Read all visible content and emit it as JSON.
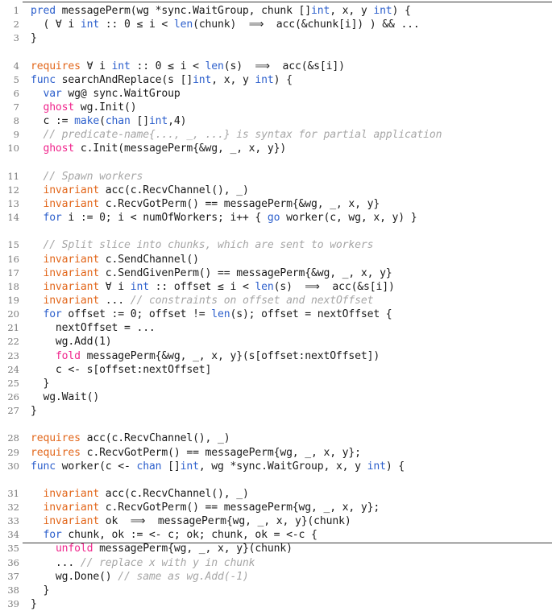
{
  "figure": {
    "kind": "code-listing",
    "language": "Gobra (Go verification)",
    "rule_color": "#3a3a3a",
    "background": "#ffffff"
  },
  "colors": {
    "keyword_blue": "#2c5fcc",
    "spec_orange": "#e2661a",
    "ghost_pink": "#f0258c",
    "comment_gray": "#a6a6a6",
    "text_black": "#1a1a1a",
    "lineno_gray": "#7b7b7b"
  },
  "lines": [
    {
      "n": "1",
      "tokens": [
        {
          "t": "pred",
          "c": "k-blue"
        },
        {
          "t": " messagePerm(wg *sync.WaitGroup, chunk []",
          "c": "plain"
        },
        {
          "t": "int",
          "c": "k-blue"
        },
        {
          "t": ", x, y ",
          "c": "plain"
        },
        {
          "t": "int",
          "c": "k-blue"
        },
        {
          "t": ") {",
          "c": "plain"
        }
      ]
    },
    {
      "n": "2",
      "tokens": [
        {
          "t": "  ( ∀ i ",
          "c": "plain"
        },
        {
          "t": "int",
          "c": "k-blue"
        },
        {
          "t": " :: 0 ≤ i < ",
          "c": "plain"
        },
        {
          "t": "len",
          "c": "k-blue"
        },
        {
          "t": "(chunk)  ⟹  acc(&chunk[i]) ) && ...",
          "c": "plain"
        }
      ]
    },
    {
      "n": "3",
      "tokens": [
        {
          "t": "}",
          "c": "plain"
        }
      ]
    },
    {
      "n": "",
      "tokens": [
        {
          "t": " ",
          "c": "plain"
        }
      ]
    },
    {
      "n": "4",
      "tokens": [
        {
          "t": "requires",
          "c": "k-orange"
        },
        {
          "t": " ∀ i ",
          "c": "plain"
        },
        {
          "t": "int",
          "c": "k-blue"
        },
        {
          "t": " :: 0 ≤ i < ",
          "c": "plain"
        },
        {
          "t": "len",
          "c": "k-blue"
        },
        {
          "t": "(s)  ⟹  acc(&s[i])",
          "c": "plain"
        }
      ]
    },
    {
      "n": "5",
      "tokens": [
        {
          "t": "func",
          "c": "k-blue"
        },
        {
          "t": " searchAndReplace(s []",
          "c": "plain"
        },
        {
          "t": "int",
          "c": "k-blue"
        },
        {
          "t": ", x, y ",
          "c": "plain"
        },
        {
          "t": "int",
          "c": "k-blue"
        },
        {
          "t": ") {",
          "c": "plain"
        }
      ]
    },
    {
      "n": "6",
      "tokens": [
        {
          "t": "  ",
          "c": "plain"
        },
        {
          "t": "var",
          "c": "k-blue"
        },
        {
          "t": " wg@ sync.WaitGroup",
          "c": "plain"
        }
      ]
    },
    {
      "n": "7",
      "tokens": [
        {
          "t": "  ",
          "c": "plain"
        },
        {
          "t": "ghost",
          "c": "k-pink"
        },
        {
          "t": " wg.Init()",
          "c": "plain"
        }
      ]
    },
    {
      "n": "8",
      "tokens": [
        {
          "t": "  c := ",
          "c": "plain"
        },
        {
          "t": "make",
          "c": "k-blue"
        },
        {
          "t": "(",
          "c": "plain"
        },
        {
          "t": "chan",
          "c": "k-blue"
        },
        {
          "t": " []",
          "c": "plain"
        },
        {
          "t": "int",
          "c": "k-blue"
        },
        {
          "t": ",4)",
          "c": "plain"
        }
      ]
    },
    {
      "n": "9",
      "tokens": [
        {
          "t": "  // predicate-name{..., _, ...} is syntax for partial application",
          "c": "cmt"
        }
      ]
    },
    {
      "n": "10",
      "tokens": [
        {
          "t": "  ",
          "c": "plain"
        },
        {
          "t": "ghost",
          "c": "k-pink"
        },
        {
          "t": " c.Init(messagePerm{&wg, _, x, y})",
          "c": "plain"
        }
      ]
    },
    {
      "n": "",
      "tokens": [
        {
          "t": " ",
          "c": "plain"
        }
      ]
    },
    {
      "n": "11",
      "tokens": [
        {
          "t": "  // Spawn workers",
          "c": "cmt"
        }
      ]
    },
    {
      "n": "12",
      "tokens": [
        {
          "t": "  ",
          "c": "plain"
        },
        {
          "t": "invariant",
          "c": "k-orange"
        },
        {
          "t": " acc(c.RecvChannel(), _)",
          "c": "plain"
        }
      ]
    },
    {
      "n": "13",
      "tokens": [
        {
          "t": "  ",
          "c": "plain"
        },
        {
          "t": "invariant",
          "c": "k-orange"
        },
        {
          "t": " c.RecvGotPerm() == messagePerm{&wg, _, x, y}",
          "c": "plain"
        }
      ]
    },
    {
      "n": "14",
      "tokens": [
        {
          "t": "  ",
          "c": "plain"
        },
        {
          "t": "for",
          "c": "k-blue"
        },
        {
          "t": " i := 0; i < numOfWorkers; i++ { ",
          "c": "plain"
        },
        {
          "t": "go",
          "c": "k-blue"
        },
        {
          "t": " worker(c, wg, x, y) }",
          "c": "plain"
        }
      ]
    },
    {
      "n": "",
      "tokens": [
        {
          "t": " ",
          "c": "plain"
        }
      ]
    },
    {
      "n": "15",
      "tokens": [
        {
          "t": "  // Split slice into chunks, which are sent to workers",
          "c": "cmt"
        }
      ]
    },
    {
      "n": "16",
      "tokens": [
        {
          "t": "  ",
          "c": "plain"
        },
        {
          "t": "invariant",
          "c": "k-orange"
        },
        {
          "t": " c.SendChannel()",
          "c": "plain"
        }
      ]
    },
    {
      "n": "17",
      "tokens": [
        {
          "t": "  ",
          "c": "plain"
        },
        {
          "t": "invariant",
          "c": "k-orange"
        },
        {
          "t": " c.SendGivenPerm() == messagePerm{&wg, _, x, y}",
          "c": "plain"
        }
      ]
    },
    {
      "n": "18",
      "tokens": [
        {
          "t": "  ",
          "c": "plain"
        },
        {
          "t": "invariant",
          "c": "k-orange"
        },
        {
          "t": " ∀ i ",
          "c": "plain"
        },
        {
          "t": "int",
          "c": "k-blue"
        },
        {
          "t": " :: offset ≤ i < ",
          "c": "plain"
        },
        {
          "t": "len",
          "c": "k-blue"
        },
        {
          "t": "(s)  ⟹  acc(&s[i])",
          "c": "plain"
        }
      ]
    },
    {
      "n": "19",
      "tokens": [
        {
          "t": "  ",
          "c": "plain"
        },
        {
          "t": "invariant",
          "c": "k-orange"
        },
        {
          "t": " ... ",
          "c": "plain"
        },
        {
          "t": "// constraints on offset and nextOffset",
          "c": "cmt"
        }
      ]
    },
    {
      "n": "20",
      "tokens": [
        {
          "t": "  ",
          "c": "plain"
        },
        {
          "t": "for",
          "c": "k-blue"
        },
        {
          "t": " offset := 0; offset != ",
          "c": "plain"
        },
        {
          "t": "len",
          "c": "k-blue"
        },
        {
          "t": "(s); offset = nextOffset {",
          "c": "plain"
        }
      ]
    },
    {
      "n": "21",
      "tokens": [
        {
          "t": "    nextOffset = ...",
          "c": "plain"
        }
      ]
    },
    {
      "n": "22",
      "tokens": [
        {
          "t": "    wg.Add(1)",
          "c": "plain"
        }
      ]
    },
    {
      "n": "23",
      "tokens": [
        {
          "t": "    ",
          "c": "plain"
        },
        {
          "t": "fold",
          "c": "k-pink"
        },
        {
          "t": " messagePerm{&wg, _, x, y}(s[offset:nextOffset])",
          "c": "plain"
        }
      ]
    },
    {
      "n": "24",
      "tokens": [
        {
          "t": "    c <- s[offset:nextOffset]",
          "c": "plain"
        }
      ]
    },
    {
      "n": "25",
      "tokens": [
        {
          "t": "  }",
          "c": "plain"
        }
      ]
    },
    {
      "n": "26",
      "tokens": [
        {
          "t": "  wg.Wait()",
          "c": "plain"
        }
      ]
    },
    {
      "n": "27",
      "tokens": [
        {
          "t": "}",
          "c": "plain"
        }
      ]
    },
    {
      "n": "",
      "tokens": [
        {
          "t": " ",
          "c": "plain"
        }
      ]
    },
    {
      "n": "28",
      "tokens": [
        {
          "t": "requires",
          "c": "k-orange"
        },
        {
          "t": " acc(c.RecvChannel(), _)",
          "c": "plain"
        }
      ]
    },
    {
      "n": "29",
      "tokens": [
        {
          "t": "requires",
          "c": "k-orange"
        },
        {
          "t": " c.RecvGotPerm() == messagePerm{wg, _, x, y};",
          "c": "plain"
        }
      ]
    },
    {
      "n": "30",
      "tokens": [
        {
          "t": "func",
          "c": "k-blue"
        },
        {
          "t": " worker(c <- ",
          "c": "plain"
        },
        {
          "t": "chan",
          "c": "k-blue"
        },
        {
          "t": " []",
          "c": "plain"
        },
        {
          "t": "int",
          "c": "k-blue"
        },
        {
          "t": ", wg *sync.WaitGroup, x, y ",
          "c": "plain"
        },
        {
          "t": "int",
          "c": "k-blue"
        },
        {
          "t": ") {",
          "c": "plain"
        }
      ]
    },
    {
      "n": "",
      "tokens": [
        {
          "t": " ",
          "c": "plain"
        }
      ]
    },
    {
      "n": "31",
      "tokens": [
        {
          "t": "  ",
          "c": "plain"
        },
        {
          "t": "invariant",
          "c": "k-orange"
        },
        {
          "t": " acc(c.RecvChannel(), _)",
          "c": "plain"
        }
      ]
    },
    {
      "n": "32",
      "tokens": [
        {
          "t": "  ",
          "c": "plain"
        },
        {
          "t": "invariant",
          "c": "k-orange"
        },
        {
          "t": " c.RecvGotPerm() == messagePerm{wg, _, x, y};",
          "c": "plain"
        }
      ]
    },
    {
      "n": "33",
      "tokens": [
        {
          "t": "  ",
          "c": "plain"
        },
        {
          "t": "invariant",
          "c": "k-orange"
        },
        {
          "t": " ok  ⟹  messagePerm{wg, _, x, y}(chunk)",
          "c": "plain"
        }
      ]
    },
    {
      "n": "34",
      "tokens": [
        {
          "t": "  ",
          "c": "plain"
        },
        {
          "t": "for",
          "c": "k-blue"
        },
        {
          "t": " chunk, ok := <- c; ok; chunk, ok = <-c {",
          "c": "plain"
        }
      ]
    },
    {
      "n": "35",
      "tokens": [
        {
          "t": "    ",
          "c": "plain"
        },
        {
          "t": "unfold",
          "c": "k-pink"
        },
        {
          "t": " messagePerm{wg, _, x, y}(chunk)",
          "c": "plain"
        }
      ]
    },
    {
      "n": "36",
      "tokens": [
        {
          "t": "    ... ",
          "c": "plain"
        },
        {
          "t": "// replace x with y in chunk",
          "c": "cmt"
        }
      ]
    },
    {
      "n": "37",
      "tokens": [
        {
          "t": "    wg.Done() ",
          "c": "plain"
        },
        {
          "t": "// same as wg.Add(-1)",
          "c": "cmt"
        }
      ]
    },
    {
      "n": "38",
      "tokens": [
        {
          "t": "  }",
          "c": "plain"
        }
      ]
    },
    {
      "n": "39",
      "tokens": [
        {
          "t": "}",
          "c": "plain"
        }
      ]
    }
  ]
}
